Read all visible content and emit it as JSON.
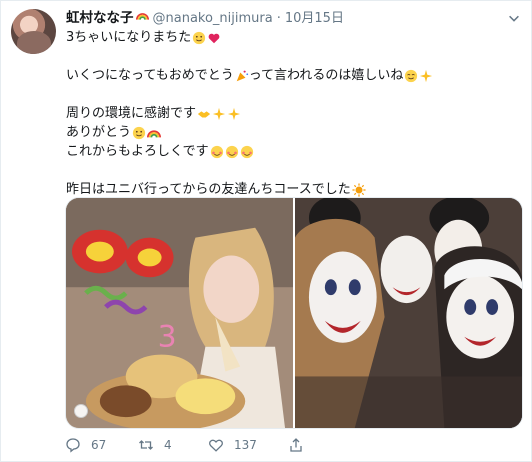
{
  "tweet": {
    "display_name": "虹村なな子",
    "handle": "@nanako_nijimura",
    "separator": "·",
    "date": "10月15日",
    "lines": [
      "3ちゃいになりまちた",
      "",
      "いくつになってもおめでとう",
      "って言われるのは嬉しいね",
      "周りの環境に感謝です",
      "ありがとう",
      "これからもよろしくです",
      "昨日はユニバ行ってからの友達んちコースでした"
    ],
    "actions": {
      "reply_count": "67",
      "retweet_count": "4",
      "like_count": "137"
    }
  },
  "icons": {
    "name_badge": "rainbow-icon",
    "menu": "chevron-down-icon",
    "reply": "reply-icon",
    "retweet": "retweet-icon",
    "like": "heart-icon",
    "share": "share-icon"
  },
  "colors": {
    "text": "#14171a",
    "secondary": "#657786",
    "border": "#e6ecf0"
  }
}
